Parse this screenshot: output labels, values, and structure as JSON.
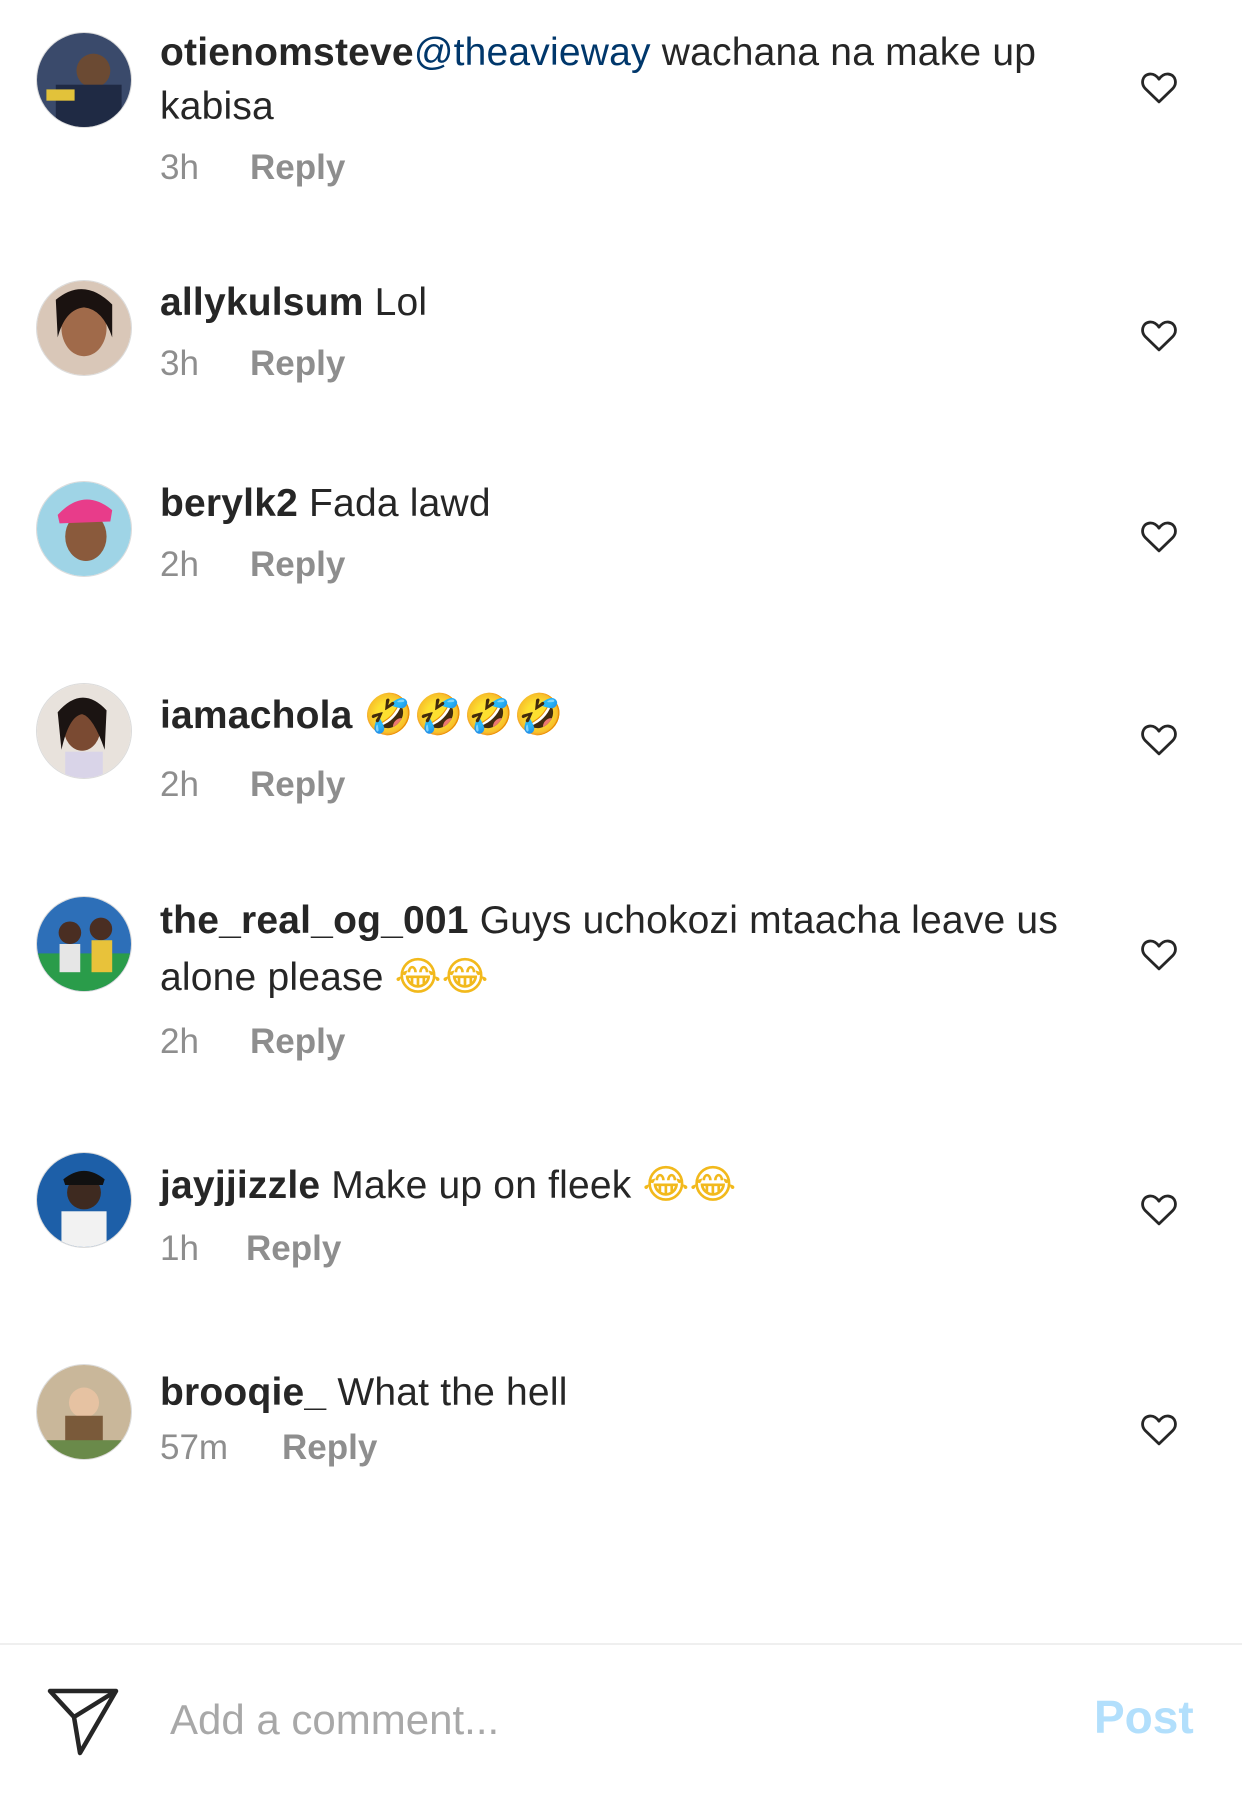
{
  "comments": [
    {
      "username": "otienomsteve",
      "mention": "@theavieway",
      "text": " wachana na make up kabisa",
      "emoji": "",
      "time": "3h",
      "reply": "Reply"
    },
    {
      "username": "allykulsum",
      "mention": "",
      "text": " Lol",
      "emoji": "",
      "time": "3h",
      "reply": "Reply"
    },
    {
      "username": "berylk2",
      "mention": "",
      "text": " Fada lawd",
      "emoji": "",
      "time": "2h",
      "reply": "Reply"
    },
    {
      "username": "iamachola",
      "mention": "",
      "text": " ",
      "emoji": "🤣🤣🤣🤣",
      "time": "2h",
      "reply": "Reply"
    },
    {
      "username": "the_real_og_001",
      "mention": "",
      "text": " Guys uchokozi mtaacha leave us alone please ",
      "emoji": "😂😂",
      "time": "2h",
      "reply": "Reply"
    },
    {
      "username": "jayjjizzle",
      "mention": "",
      "text": " Make up on fleek ",
      "emoji": "😂😂",
      "time": "1h",
      "reply": "Reply"
    },
    {
      "username": "brooqie_",
      "mention": "",
      "text": " What the hell",
      "emoji": "",
      "time": "57m",
      "reply": "Reply"
    }
  ],
  "composer": {
    "placeholder": "Add a comment...",
    "post_label": "Post"
  },
  "colors": {
    "mention": "#00376b",
    "secondary": "#8e8e8e",
    "post_disabled": "#b2dffc"
  },
  "icons": {
    "like": "heart-outline-icon",
    "send": "paper-plane-icon"
  }
}
